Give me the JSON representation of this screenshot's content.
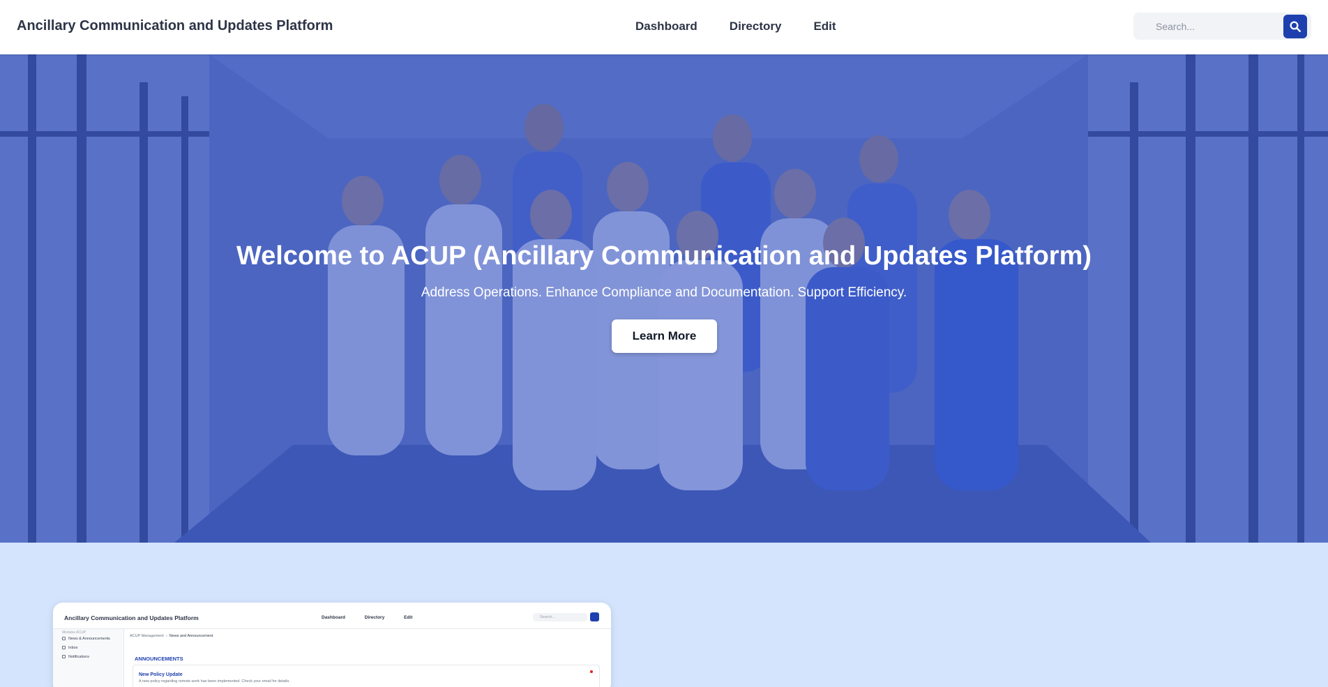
{
  "header": {
    "title": "Ancillary Communication and Updates Platform",
    "nav": [
      "Dashboard",
      "Directory",
      "Edit"
    ],
    "search_placeholder": "Search..."
  },
  "hero": {
    "title": "Welcome to ACUP (Ancillary Communication and Updates Platform)",
    "subtitle": "Address Operations. Enhance Compliance and Documentation. Support Efficiency.",
    "button_label": "Learn More"
  },
  "preview": {
    "title": "Ancillary Communication and Updates Platform",
    "nav": [
      "Dashboard",
      "Directory",
      "Edit"
    ],
    "search_placeholder": "Search...",
    "sidebar_caption": "Modules ACUP",
    "sidebar_items": [
      "News & Announcements",
      "Inbox",
      "Notifications"
    ],
    "breadcrumb": [
      "ACUP Management",
      "News and Announcement"
    ],
    "section_heading": "ANNOUNCEMENTS",
    "item_title": "New Policy Update",
    "item_text": "A new policy regarding remote work has been implemented. Check your email for details."
  },
  "colors": {
    "accent": "#1e40af",
    "page_background": "#d4e4fd",
    "hero_overlay": "#2d4bbe"
  }
}
